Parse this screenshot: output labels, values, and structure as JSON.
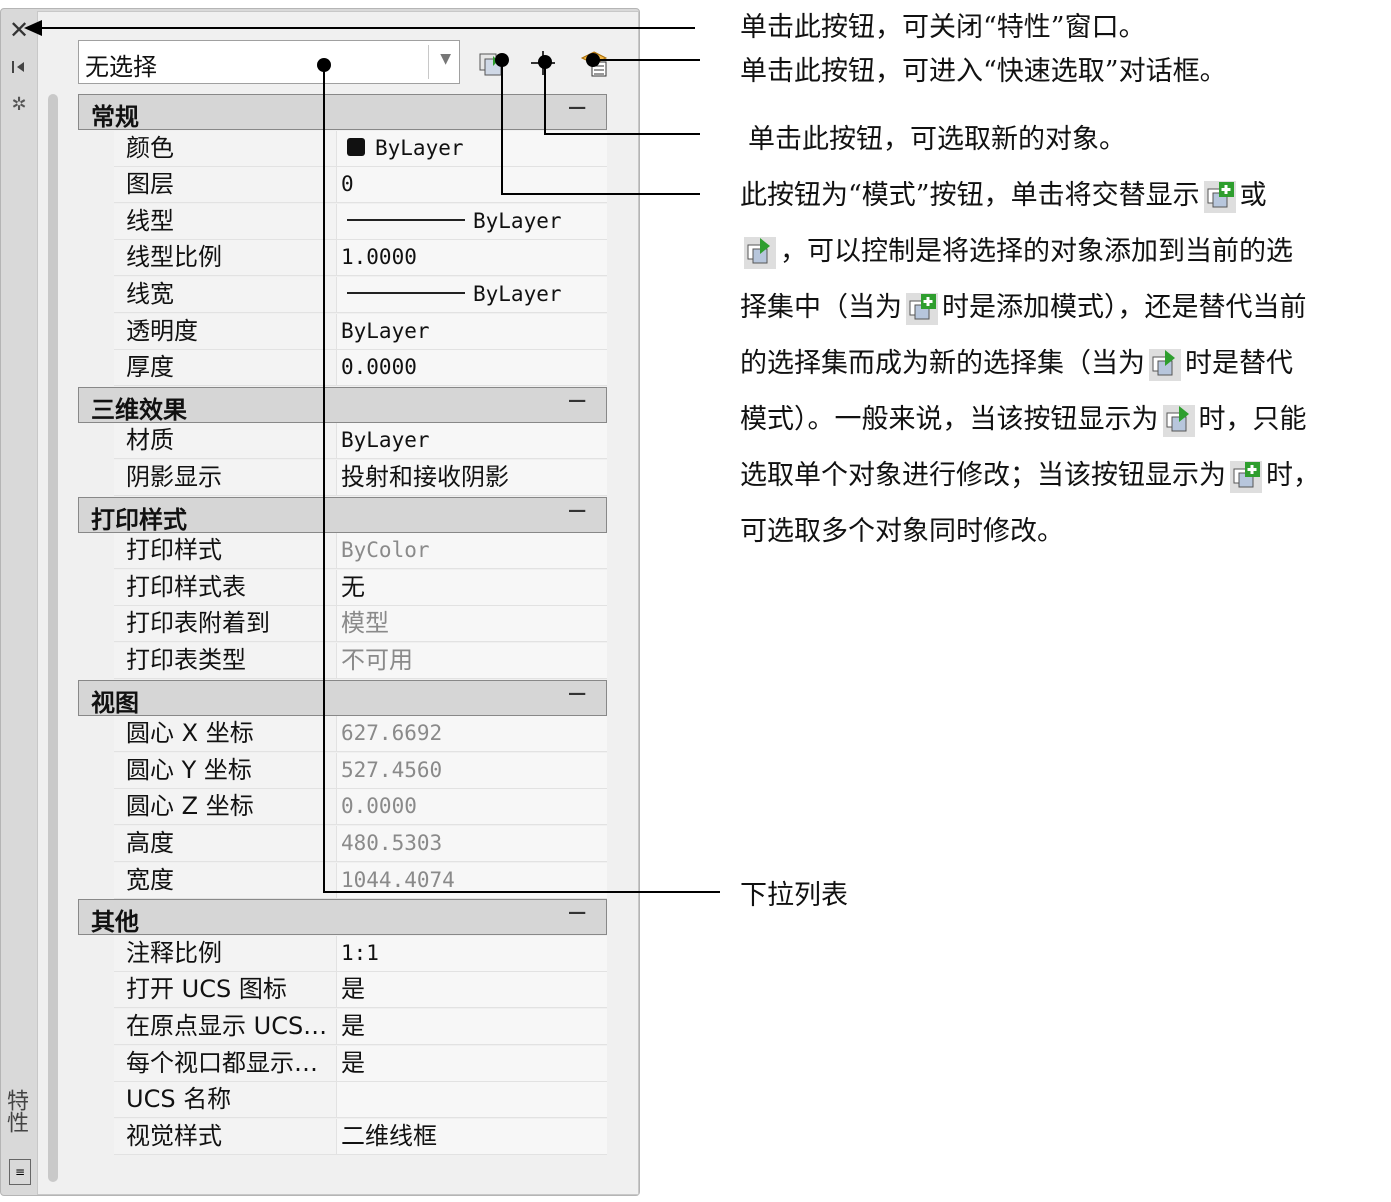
{
  "panel": {
    "side_title": "特性",
    "dropdown": {
      "value": "无选择"
    },
    "sections": [
      {
        "title": "常规",
        "toggle": "−",
        "rows": [
          {
            "name": "颜色",
            "value": "ByLayer",
            "style": "swatch"
          },
          {
            "name": "图层",
            "value": "0"
          },
          {
            "name": "线型",
            "value": "ByLayer",
            "style": "line"
          },
          {
            "name": "线型比例",
            "value": "1.0000"
          },
          {
            "name": "线宽",
            "value": "ByLayer",
            "style": "line"
          },
          {
            "name": "透明度",
            "value": "ByLayer"
          },
          {
            "name": "厚度",
            "value": "0.0000"
          }
        ]
      },
      {
        "title": "三维效果",
        "toggle": "−",
        "rows": [
          {
            "name": "材质",
            "value": "ByLayer"
          },
          {
            "name": "阴影显示",
            "value": "投射和接收阴影",
            "style": "cjk"
          }
        ]
      },
      {
        "title": "打印样式",
        "toggle": "−",
        "rows": [
          {
            "name": "打印样式",
            "value": "ByColor",
            "style": "gray"
          },
          {
            "name": "打印样式表",
            "value": "无",
            "style": "cjk"
          },
          {
            "name": "打印表附着到",
            "value": "模型",
            "style": "cjk-gray"
          },
          {
            "name": "打印表类型",
            "value": "不可用",
            "style": "cjk-gray"
          }
        ]
      },
      {
        "title": "视图",
        "toggle": "−",
        "rows": [
          {
            "name": "圆心 X 坐标",
            "value": "627.6692",
            "style": "gray"
          },
          {
            "name": "圆心 Y 坐标",
            "value": "527.4560",
            "style": "gray"
          },
          {
            "name": "圆心 Z 坐标",
            "value": "0.0000",
            "style": "gray"
          },
          {
            "name": "高度",
            "value": "480.5303",
            "style": "gray"
          },
          {
            "name": "宽度",
            "value": "1044.4074",
            "style": "gray"
          }
        ]
      },
      {
        "title": "其他",
        "toggle": "−",
        "rows": [
          {
            "name": "注释比例",
            "value": "1:1"
          },
          {
            "name": "打开 UCS 图标",
            "value": "是",
            "style": "cjk"
          },
          {
            "name": "在原点显示 UCS…",
            "value": "是",
            "style": "cjk"
          },
          {
            "name": "每个视口都显示…",
            "value": "是",
            "style": "cjk"
          },
          {
            "name": "UCS 名称",
            "value": ""
          },
          {
            "name": "视觉样式",
            "value": "二维线框",
            "style": "cjk"
          }
        ]
      }
    ]
  },
  "annotations": {
    "close": "单击此按钮，可关闭“特性”窗口。",
    "quick_select": "单击此按钮，可进入“快速选取”对话框。",
    "select_objects": "单击此按钮，可选取新的对象。",
    "mode_p1": "此按钮为“模式”按钮，单击将交替显示",
    "mode_p2": "或",
    "mode_p3": "，可以控制是将选择的对象添加到当前的选",
    "mode_p4": "择集中（当为",
    "mode_p5": "时是添加模式），还是替代当前",
    "mode_p6": "的选择集而成为新的选择集（当为",
    "mode_p7": "时是替代",
    "mode_p8": "模式）。一般来说，当该按钮显示为",
    "mode_p9": "时，只能",
    "mode_p10": "选取单个对象进行修改；当该按钮显示为",
    "mode_p11": "时，",
    "mode_p12": "可选取多个对象同时修改。",
    "dropdown": "下拉列表"
  },
  "colors": {
    "accent_green": "#2e9e2e",
    "header_bg": "#d6d6d6",
    "panel_bg": "#f0f0f0"
  }
}
